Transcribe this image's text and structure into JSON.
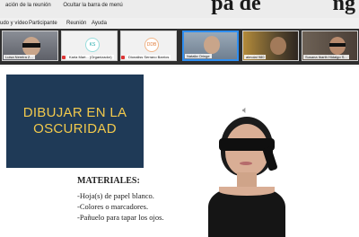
{
  "header": {
    "big_title_fragment": "pa de",
    "big_title_end": "ng",
    "line1_left": "ación de la reunión",
    "line1_right": "Ocultar la barra de menú"
  },
  "menu": {
    "items": [
      "udo y vídeo",
      "Participante",
      "Reunión",
      "Ayuda"
    ]
  },
  "participants": [
    {
      "name": "Luisa Nereira Z...",
      "type": "video"
    },
    {
      "name": "Karla Mart... (Organizador)",
      "type": "avatar",
      "initials": "KS"
    },
    {
      "name": "Dionaliss Serrano Barrios",
      "type": "avatar",
      "initials": "DDB"
    },
    {
      "name": "Natalia Oringe",
      "type": "video",
      "selected": true
    },
    {
      "name": "almolal 980",
      "type": "video"
    },
    {
      "name": "Susana Ibarth Hidalgo S...",
      "type": "video"
    }
  ],
  "slide": {
    "title_line1": "DIBUJAR EN LA",
    "title_line2": "OSCURIDAD",
    "speaker_icon": "speaker-icon",
    "materials_heading": "MATERIALES:",
    "materials": [
      "-Hoja(s) de papel blanco.",
      "-Colores o marcadores.",
      "-Pañuelo para tapar los ojos."
    ]
  },
  "colors": {
    "title_box": "#1f3a57",
    "title_text": "#f2c94c",
    "selected_border": "#2f8ef0"
  }
}
